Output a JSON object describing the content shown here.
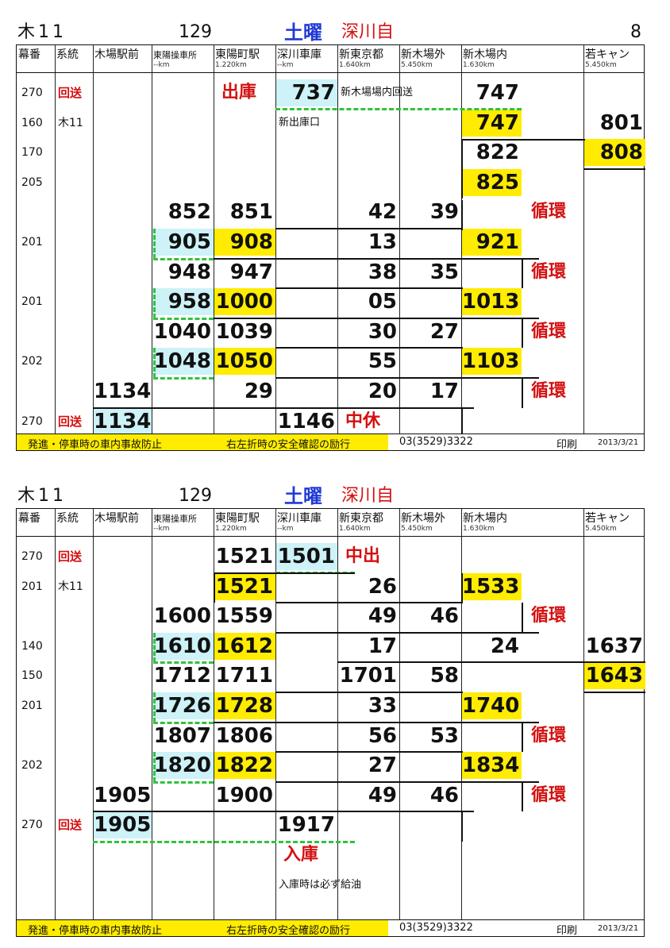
{
  "sheets": [
    {
      "route": "木11",
      "number": "129",
      "day": "土曜",
      "depot": "深川自",
      "page": "8"
    },
    {
      "route": "木11",
      "number": "129",
      "day": "土曜",
      "depot": "深川自",
      "page": ""
    }
  ],
  "columns": [
    "幕番",
    "系統",
    "木場駅前",
    "東陽操車所",
    "東陽町駅",
    "深川車庫",
    "新東京都",
    "新木場外",
    "新木場内",
    "",
    "若キャン"
  ],
  "km": [
    "",
    "",
    "",
    "--km",
    "1.220km",
    "--km",
    "1.640km",
    "5.450km",
    "1.630km",
    "",
    "5.450km"
  ],
  "top_rows": [
    {
      "code": "270",
      "system": "回送",
      "cells": [
        "",
        "",
        "出庫",
        "737",
        "新木場場内回送",
        "",
        "747",
        "",
        ""
      ]
    },
    {
      "code": "160",
      "system": "木11",
      "cells": [
        "",
        "",
        "",
        "新出庫口",
        "",
        "",
        "747",
        "",
        "801"
      ]
    },
    {
      "code": "170",
      "system": "",
      "cells": [
        "",
        "",
        "",
        "",
        "",
        "",
        "822",
        "",
        "808"
      ]
    },
    {
      "code": "205",
      "system": "",
      "cells": [
        "",
        "",
        "",
        "",
        "",
        "",
        "825",
        "",
        ""
      ]
    },
    {
      "code": "",
      "system": "",
      "cells": [
        "",
        "852",
        "851",
        "",
        "42",
        "39",
        "",
        "循環",
        ""
      ]
    },
    {
      "code": "201",
      "system": "",
      "cells": [
        "",
        "905",
        "908",
        "",
        "13",
        "",
        "921",
        "",
        ""
      ]
    },
    {
      "code": "",
      "system": "",
      "cells": [
        "",
        "948",
        "947",
        "",
        "38",
        "35",
        "",
        "循環",
        ""
      ]
    },
    {
      "code": "201",
      "system": "",
      "cells": [
        "",
        "958",
        "1000",
        "",
        "05",
        "",
        "1013",
        "",
        ""
      ]
    },
    {
      "code": "",
      "system": "",
      "cells": [
        "",
        "1040",
        "1039",
        "",
        "30",
        "27",
        "",
        "循環",
        ""
      ]
    },
    {
      "code": "202",
      "system": "",
      "cells": [
        "",
        "1048",
        "1050",
        "",
        "55",
        "",
        "1103",
        "",
        ""
      ]
    },
    {
      "code": "",
      "system": "",
      "cells": [
        "1134",
        "",
        "29",
        "",
        "20",
        "17",
        "",
        "循環",
        ""
      ]
    },
    {
      "code": "270",
      "system": "回送",
      "cells": [
        "1134",
        "",
        "",
        "1146",
        "中休",
        "",
        "",
        "",
        ""
      ]
    }
  ],
  "bottom_rows": [
    {
      "code": "270",
      "system": "回送",
      "cells": [
        "",
        "",
        "1521",
        "1501",
        "中出",
        "",
        "",
        "",
        ""
      ]
    },
    {
      "code": "201",
      "system": "木11",
      "cells": [
        "",
        "",
        "1521",
        "",
        "26",
        "",
        "1533",
        "",
        ""
      ]
    },
    {
      "code": "",
      "system": "",
      "cells": [
        "",
        "1600",
        "1559",
        "",
        "49",
        "46",
        "",
        "循環",
        ""
      ]
    },
    {
      "code": "140",
      "system": "",
      "cells": [
        "",
        "1610",
        "1612",
        "",
        "17",
        "",
        "24",
        "",
        "1637"
      ]
    },
    {
      "code": "150",
      "system": "",
      "cells": [
        "",
        "1712",
        "1711",
        "",
        "1701",
        "58",
        "",
        "",
        "1643"
      ]
    },
    {
      "code": "201",
      "system": "",
      "cells": [
        "",
        "1726",
        "1728",
        "",
        "33",
        "",
        "1740",
        "",
        ""
      ]
    },
    {
      "code": "",
      "system": "",
      "cells": [
        "",
        "1807",
        "1806",
        "",
        "56",
        "53",
        "",
        "循環",
        ""
      ]
    },
    {
      "code": "202",
      "system": "",
      "cells": [
        "",
        "1820",
        "1822",
        "",
        "27",
        "",
        "1834",
        "",
        ""
      ]
    },
    {
      "code": "",
      "system": "",
      "cells": [
        "1905",
        "",
        "1900",
        "",
        "49",
        "46",
        "",
        "循環",
        ""
      ]
    },
    {
      "code": "270",
      "system": "回送",
      "cells": [
        "1905",
        "",
        "",
        "1917",
        "",
        "",
        "",
        "",
        ""
      ]
    },
    {
      "code": "",
      "system": "",
      "cells": [
        "",
        "",
        "",
        "入庫",
        "",
        "",
        "",
        "",
        ""
      ]
    },
    {
      "code": "",
      "system": "",
      "cells": [
        "",
        "",
        "",
        "入庫時は必ず給油",
        "",
        "",
        "",
        "",
        ""
      ]
    }
  ],
  "footer": {
    "slogan1": "発進・停車時の車内事故防止",
    "slogan2": "右左折時の安全確認の励行",
    "phone": "03(3529)3322",
    "print": "印刷",
    "date": "2013/3/21"
  },
  "colors": {
    "highlight": "#ffec00",
    "cyan": "#cdf2f7",
    "red": "#d41010",
    "blue": "#1f39d6",
    "dash": "#2ec43c"
  }
}
